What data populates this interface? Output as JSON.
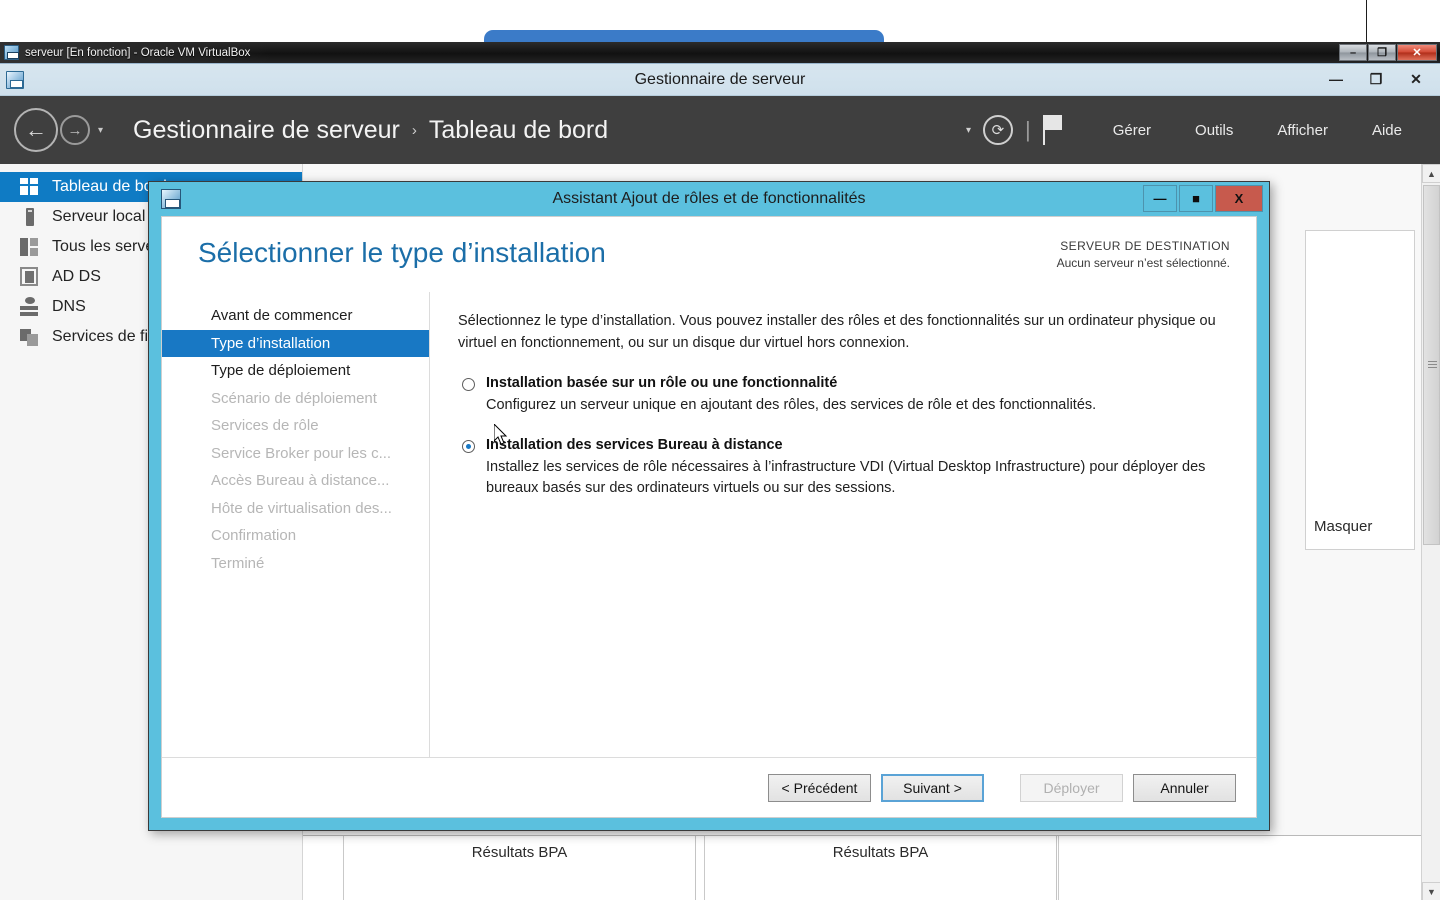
{
  "host": {
    "vbox_titlebar": {
      "icon": "virtualbox-icon",
      "title": "serveur [En fonction] - Oracle VM VirtualBox",
      "minimize": "–",
      "maximize": "❐",
      "close": "✕"
    }
  },
  "server_manager": {
    "titlebar": {
      "icon": "server-manager-icon",
      "title": "Gestionnaire de serveur",
      "minimize": "—",
      "maximize": "❐",
      "close": "✕"
    },
    "navbar": {
      "back_icon": "←",
      "forward_icon": "→",
      "dropdown_caret": "▾",
      "breadcrumb": [
        "Gestionnaire de serveur",
        "Tableau de bord"
      ],
      "breadcrumb_separator": "›",
      "refresh_icon": "⟳",
      "pipe": "|",
      "menu": [
        "Gérer",
        "Outils",
        "Afficher",
        "Aide"
      ]
    },
    "sidebar": [
      {
        "label": "Tableau de bord",
        "icon": "dashboard-icon",
        "active": true
      },
      {
        "label": "Serveur local",
        "icon": "local-server-icon",
        "active": false
      },
      {
        "label": "Tous les serveurs",
        "icon": "all-servers-icon",
        "active": false
      },
      {
        "label": "AD DS",
        "icon": "ad-ds-icon",
        "active": false
      },
      {
        "label": "DNS",
        "icon": "dns-icon",
        "active": false
      },
      {
        "label": "Services de fichiers et de stockage",
        "icon": "file-services-icon",
        "active": false
      }
    ],
    "right_card": {
      "hide_label": "Masquer"
    },
    "bpa_cells": [
      "Résultats BPA",
      "Résultats BPA"
    ],
    "scrollbar": {
      "up": "▲",
      "down": "▼"
    }
  },
  "wizard": {
    "titlebar": {
      "icon": "wizard-icon",
      "title": "Assistant Ajout de rôles et de fonctionnalités",
      "minimize": "—",
      "maximize": "■",
      "close": "X"
    },
    "heading": "Sélectionner le type d’installation",
    "destination": {
      "label": "SERVEUR DE DESTINATION",
      "value": "Aucun serveur n’est sélectionné."
    },
    "steps": [
      {
        "label": "Avant de commencer",
        "state": "enabled"
      },
      {
        "label": "Type d’installation",
        "state": "active"
      },
      {
        "label": "Type de déploiement",
        "state": "enabled"
      },
      {
        "label": "Scénario de déploiement",
        "state": "disabled"
      },
      {
        "label": "Services de rôle",
        "state": "disabled"
      },
      {
        "label": "Service Broker pour les c...",
        "state": "disabled"
      },
      {
        "label": "Accès Bureau à distance...",
        "state": "disabled"
      },
      {
        "label": "Hôte de virtualisation des...",
        "state": "disabled"
      },
      {
        "label": "Confirmation",
        "state": "disabled"
      },
      {
        "label": "Terminé",
        "state": "disabled"
      }
    ],
    "intro": "Sélectionnez le type d’installation. Vous pouvez installer des rôles et des fonctionnalités sur un ordinateur physique ou virtuel en fonctionnement, ou sur un disque dur virtuel hors connexion.",
    "options": [
      {
        "title": "Installation basée sur un rôle ou une fonctionnalité",
        "description": "Configurez un serveur unique en ajoutant des rôles, des services de rôle et des fonctionnalités.",
        "selected": false
      },
      {
        "title": "Installation des services Bureau à distance",
        "description": "Installez les services de rôle nécessaires à l’infrastructure VDI (Virtual Desktop Infrastructure) pour déployer des bureaux basés sur des ordinateurs virtuels ou sur des sessions.",
        "selected": true
      }
    ],
    "buttons": {
      "previous": "< Précédent",
      "next": "Suivant >",
      "deploy": "Déployer",
      "cancel": "Annuler"
    }
  },
  "colors": {
    "accent_blue": "#1878c4",
    "wizard_frame": "#5bc0de",
    "navbar_dark": "#3f3f3f",
    "heading_blue": "#1b6ea8",
    "close_red": "#c75a4d"
  }
}
